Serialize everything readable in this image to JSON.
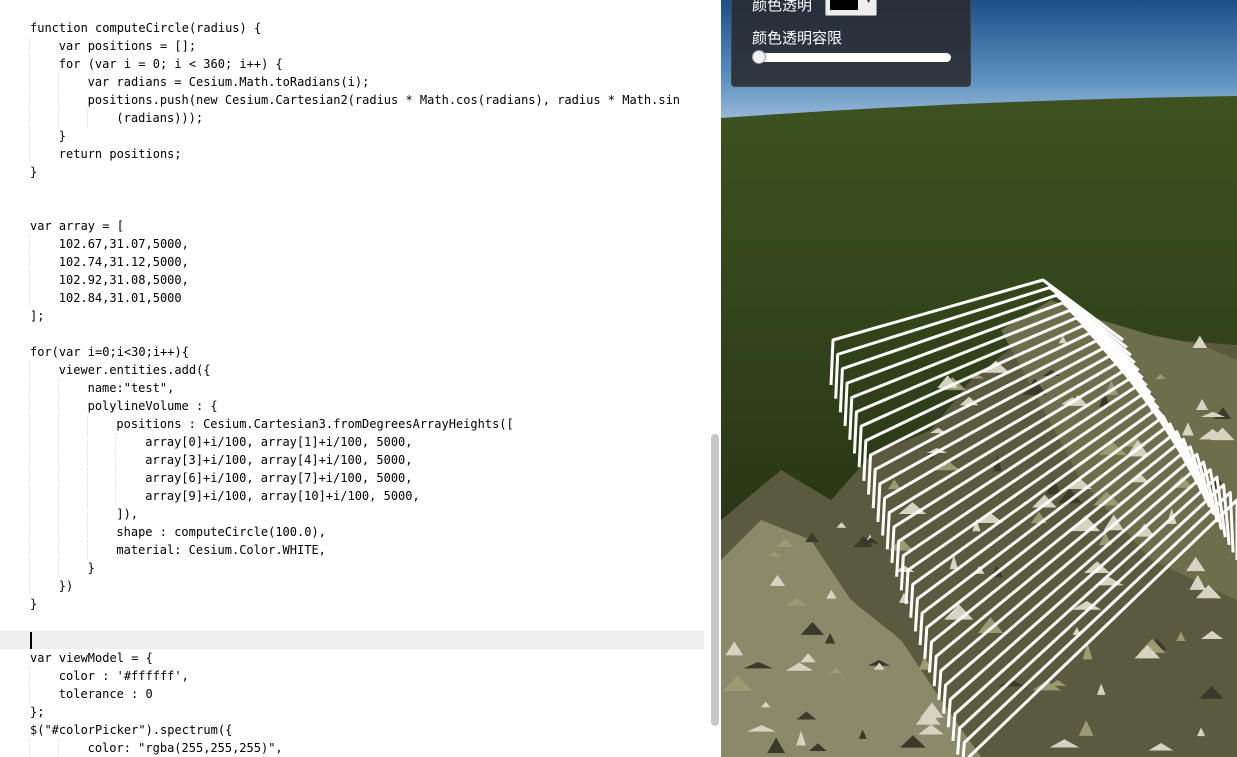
{
  "editor": {
    "lines": [
      {
        "indent": 0,
        "text": "function computeCircle(radius) {"
      },
      {
        "indent": 1,
        "text": "var positions = [];"
      },
      {
        "indent": 1,
        "text": "for (var i = 0; i < 360; i++) {"
      },
      {
        "indent": 2,
        "text": "var radians = Cesium.Math.toRadians(i);"
      },
      {
        "indent": 2,
        "text": "positions.push(new Cesium.Cartesian2(radius * Math.cos(radians), radius * Math.sin"
      },
      {
        "indent": 3,
        "text": "(radians)));"
      },
      {
        "indent": 1,
        "text": "}"
      },
      {
        "indent": 1,
        "text": "return positions;"
      },
      {
        "indent": 0,
        "text": "}"
      },
      {
        "indent": 0,
        "text": ""
      },
      {
        "indent": 0,
        "text": ""
      },
      {
        "indent": 0,
        "text": "var array = ["
      },
      {
        "indent": 1,
        "text": "102.67,31.07,5000,"
      },
      {
        "indent": 1,
        "text": "102.74,31.12,5000,"
      },
      {
        "indent": 1,
        "text": "102.92,31.08,5000,"
      },
      {
        "indent": 1,
        "text": "102.84,31.01,5000"
      },
      {
        "indent": 0,
        "text": "];"
      },
      {
        "indent": 0,
        "text": ""
      },
      {
        "indent": 0,
        "text": "for(var i=0;i<30;i++){"
      },
      {
        "indent": 1,
        "text": "viewer.entities.add({"
      },
      {
        "indent": 2,
        "text": "name:\"test\","
      },
      {
        "indent": 2,
        "text": "polylineVolume : {"
      },
      {
        "indent": 3,
        "text": "positions : Cesium.Cartesian3.fromDegreesArrayHeights(["
      },
      {
        "indent": 4,
        "text": "array[0]+i/100, array[1]+i/100, 5000,"
      },
      {
        "indent": 4,
        "text": "array[3]+i/100, array[4]+i/100, 5000,"
      },
      {
        "indent": 4,
        "text": "array[6]+i/100, array[7]+i/100, 5000,"
      },
      {
        "indent": 4,
        "text": "array[9]+i/100, array[10]+i/100, 5000,"
      },
      {
        "indent": 3,
        "text": "]),"
      },
      {
        "indent": 3,
        "text": "shape : computeCircle(100.0),"
      },
      {
        "indent": 3,
        "text": "material: Cesium.Color.WHITE,"
      },
      {
        "indent": 2,
        "text": "}"
      },
      {
        "indent": 1,
        "text": "})"
      },
      {
        "indent": 0,
        "text": "}"
      },
      {
        "indent": 0,
        "text": ""
      },
      {
        "indent": 0,
        "text": ""
      },
      {
        "indent": 0,
        "text": "var viewModel = {"
      },
      {
        "indent": 1,
        "text": "color : '#ffffff',"
      },
      {
        "indent": 1,
        "text": "tolerance : 0"
      },
      {
        "indent": 0,
        "text": "};"
      },
      {
        "indent": 0,
        "text": "$(\"#colorPicker\").spectrum({"
      },
      {
        "indent": 2,
        "text": "color: \"rgba(255,255,255)\","
      }
    ]
  },
  "toolbar": {
    "color_label": "颜色透明",
    "tolerance_label": "颜色透明容限",
    "selected_color": "#000000",
    "tolerance_value": 0
  },
  "viewer": {
    "wall_count": 30,
    "wall_color": "#ffffff"
  }
}
